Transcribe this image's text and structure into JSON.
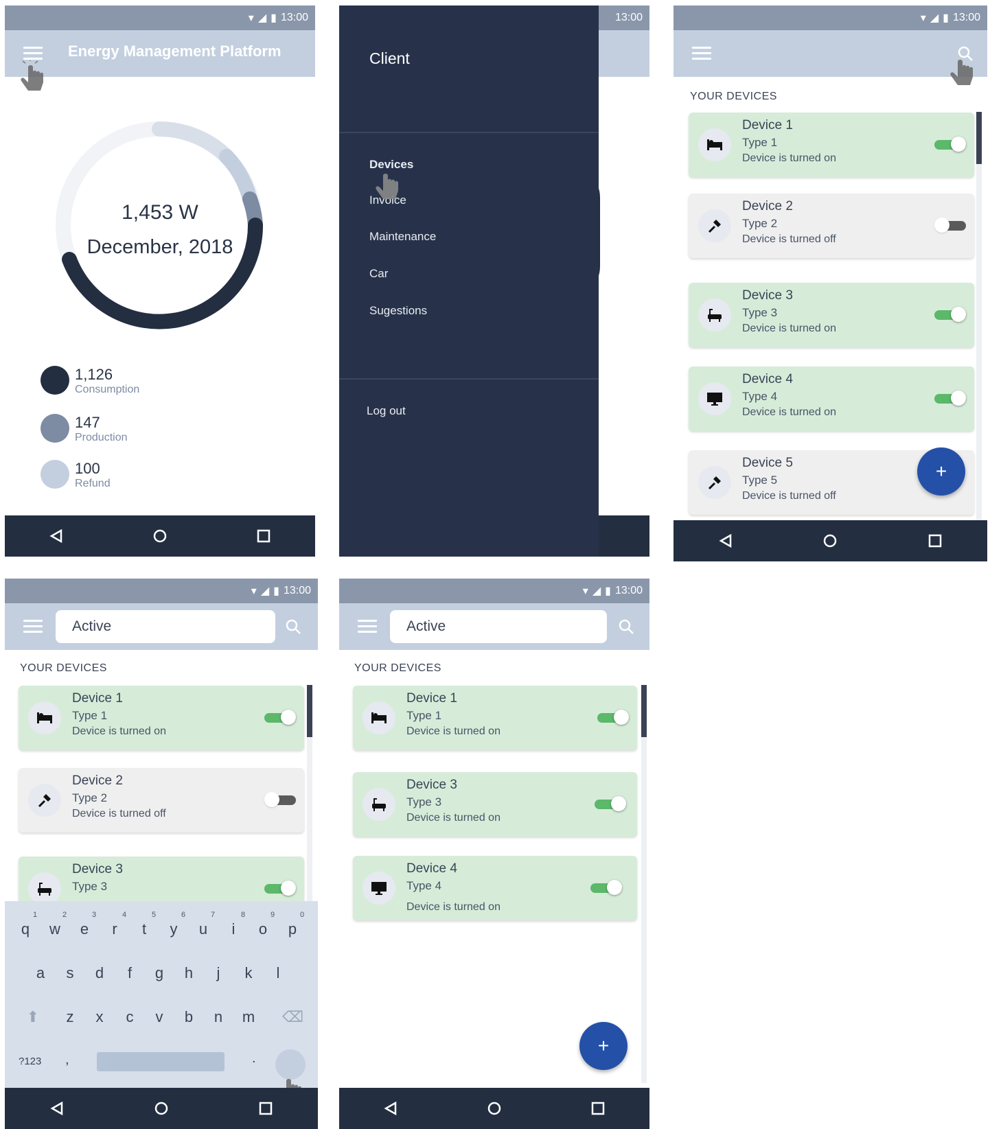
{
  "status_time": "13:00",
  "screen1": {
    "title": "Energy Management Platform",
    "gauge_value": "1,453 W",
    "gauge_period": "December, 2018",
    "legend": [
      {
        "value": "1,126",
        "label": "Consumption",
        "color": "#232e40"
      },
      {
        "value": "147",
        "label": "Production",
        "color": "#7d8ba3"
      },
      {
        "value": "100",
        "label": "Refund",
        "color": "#c3cfdf"
      }
    ]
  },
  "screen2": {
    "drawer_title": "Client",
    "menu": [
      "Devices",
      "Invoice",
      "Maintenance",
      "Car",
      "Sugestions"
    ],
    "logout": "Log out"
  },
  "devices_title": "YOUR DEVICES",
  "devices": [
    {
      "name": "Device 1",
      "type": "Type 1",
      "status": "Device is turned on",
      "on": true,
      "icon": "bed-icon"
    },
    {
      "name": "Device 2",
      "type": "Type 2",
      "status": "Device is turned off",
      "on": false,
      "icon": "tool-icon"
    },
    {
      "name": "Device 3",
      "type": "Type 3",
      "status": "Device is turned on",
      "on": true,
      "icon": "bathtub-icon"
    },
    {
      "name": "Device 4",
      "type": "Type 4",
      "status": "Device is turned on",
      "on": true,
      "icon": "monitor-icon"
    },
    {
      "name": "Device 5",
      "type": "Type 5",
      "status": "Device is turned off",
      "on": false,
      "icon": "tool-icon"
    }
  ],
  "search": {
    "value": "Active"
  },
  "keyboard": {
    "row1": [
      "q",
      "w",
      "e",
      "r",
      "t",
      "y",
      "u",
      "i",
      "o",
      "p"
    ],
    "row1_nums": [
      "1",
      "2",
      "3",
      "4",
      "5",
      "6",
      "7",
      "8",
      "9",
      "0"
    ],
    "row2": [
      "a",
      "s",
      "d",
      "f",
      "g",
      "h",
      "j",
      "k",
      "l"
    ],
    "row3": [
      "z",
      "x",
      "c",
      "v",
      "b",
      "n",
      "m"
    ],
    "symbols": "?123",
    "comma": ",",
    "period": "."
  },
  "fab_label": "+",
  "colors": {
    "dark": "#232e40",
    "appbar": "#c3cfdf",
    "status": "#8a97ab",
    "card_on": "#d6ecd9",
    "toggle_on": "#5cb86a",
    "fab": "#2450a8"
  }
}
